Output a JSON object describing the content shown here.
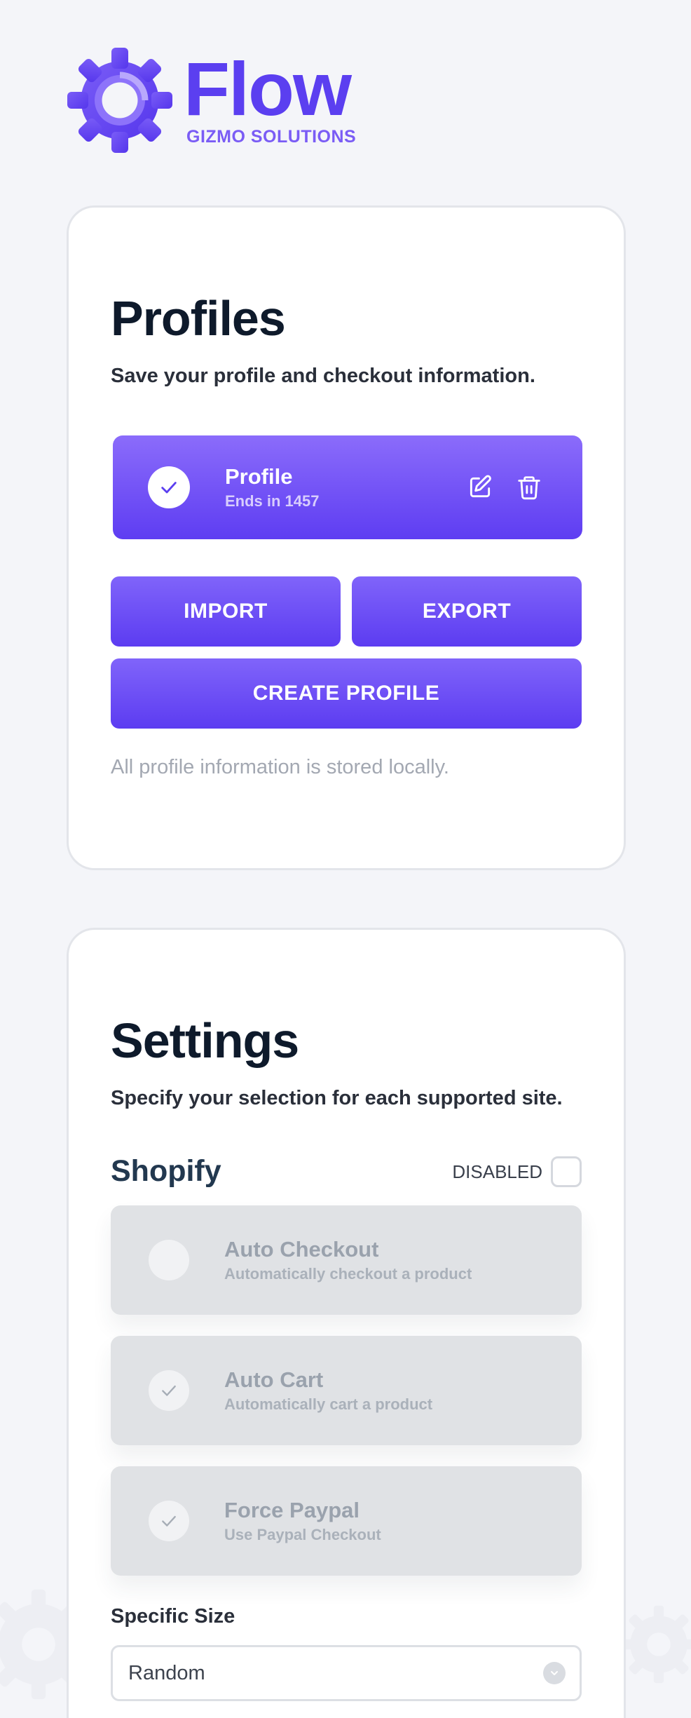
{
  "brand": {
    "name": "Flow",
    "subtitle": "GIZMO SOLUTIONS",
    "icon": "gear-icon",
    "color": "#5b3ff0"
  },
  "profiles": {
    "title": "Profiles",
    "subtitle": "Save your profile and checkout information.",
    "items": [
      {
        "name": "Profile",
        "detail": "Ends in 1457",
        "selected": true
      }
    ],
    "buttons": {
      "import": "IMPORT",
      "export": "EXPORT",
      "create": "CREATE PROFILE"
    },
    "note": "All profile information is stored locally."
  },
  "settings": {
    "title": "Settings",
    "subtitle": "Specify your selection for each supported site.",
    "site": "Shopify",
    "toggle_label": "DISABLED",
    "toggle_checked": false,
    "options": [
      {
        "title": "Auto Checkout",
        "subtitle": "Automatically checkout a product",
        "checked": false
      },
      {
        "title": "Auto Cart",
        "subtitle": "Automatically cart a product",
        "checked": true
      },
      {
        "title": "Force Paypal",
        "subtitle": "Use Paypal Checkout",
        "checked": true
      }
    ],
    "size_label": "Specific Size",
    "size_value": "Random"
  },
  "colors": {
    "accent": "#6a4cf5",
    "accent_light": "#8b6cfb",
    "background": "#f4f5f9",
    "disabled_card": "#e0e2e5"
  }
}
